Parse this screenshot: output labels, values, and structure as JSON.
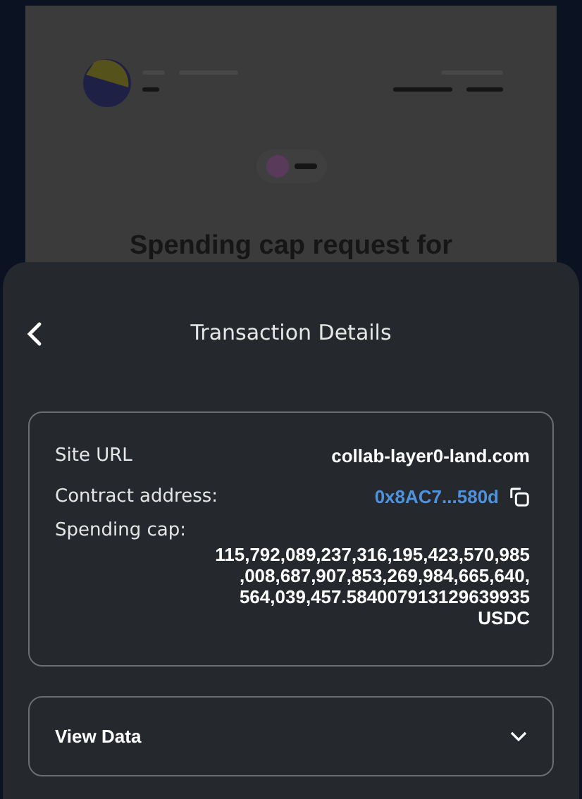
{
  "background_page": {
    "heading": "Spending cap request for"
  },
  "sheet": {
    "title": "Transaction Details",
    "details": [
      {
        "kind": "text",
        "label": "Site URL",
        "value": "collab-layer0-land.com"
      },
      {
        "kind": "address",
        "label": "Contract address:",
        "value": "0x8AC7...580d"
      }
    ],
    "spending_cap": {
      "label": "Spending cap:",
      "lines": [
        "115,792,089,237,316,195,423,570,985",
        ",008,687,907,853,269,984,665,640,",
        "564,039,457.584007913129639935",
        "USDC"
      ]
    },
    "view_data": {
      "label": "View Data",
      "expanded": false
    }
  }
}
